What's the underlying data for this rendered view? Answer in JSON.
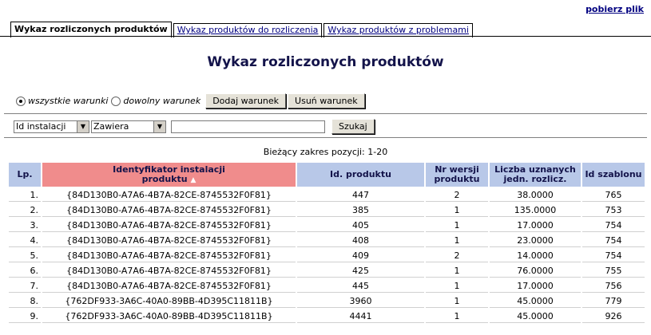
{
  "header": {
    "download_link": "pobierz plik"
  },
  "tabs": [
    {
      "label": "Wykaz rozliczonych produktów",
      "active": true
    },
    {
      "label": "Wykaz produktów do rozliczenia",
      "active": false
    },
    {
      "label": "Wykaz produktów z problemami",
      "active": false
    }
  ],
  "page_title": "Wykaz rozliczonych produktów",
  "conditions": {
    "radio_all": "wszystkie warunki",
    "radio_any": "dowolny warunek",
    "selected": "all",
    "add_button": "Dodaj warunek",
    "remove_button": "Usuń warunek"
  },
  "filter": {
    "field_select": "Id instalacji",
    "operator_select": "Zawiera",
    "value": "",
    "search_button": "Szukaj"
  },
  "range_text": "Bieżący zakres pozycji: 1-20",
  "table": {
    "columns": [
      "Lp.",
      "Identyfikator instalacji produktu",
      "Id. produktu",
      "Nr wersji produktu",
      "Liczba uznanych jedn. rozlicz.",
      "Id szablonu"
    ],
    "col_labels": {
      "lp": "Lp.",
      "install_id_1": "Identyfikator instalacji",
      "install_id_2": "produktu",
      "product_id": "Id. produktu",
      "version_1": "Nr wersji",
      "version_2": "produktu",
      "units_1": "Liczba uznanych",
      "units_2": "jedn. rozlicz.",
      "template": "Id szablonu"
    },
    "sort_indicator": "▲",
    "rows": [
      [
        "1.",
        "{84D130B0-A7A6-4B7A-82CE-8745532F0F81}",
        "447",
        "2",
        "38.0000",
        "765"
      ],
      [
        "2.",
        "{84D130B0-A7A6-4B7A-82CE-8745532F0F81}",
        "385",
        "1",
        "135.0000",
        "753"
      ],
      [
        "3.",
        "{84D130B0-A7A6-4B7A-82CE-8745532F0F81}",
        "405",
        "1",
        "17.0000",
        "754"
      ],
      [
        "4.",
        "{84D130B0-A7A6-4B7A-82CE-8745532F0F81}",
        "408",
        "1",
        "23.0000",
        "754"
      ],
      [
        "5.",
        "{84D130B0-A7A6-4B7A-82CE-8745532F0F81}",
        "409",
        "2",
        "14.0000",
        "754"
      ],
      [
        "6.",
        "{84D130B0-A7A6-4B7A-82CE-8745532F0F81}",
        "425",
        "1",
        "76.0000",
        "755"
      ],
      [
        "7.",
        "{84D130B0-A7A6-4B7A-82CE-8745532F0F81}",
        "445",
        "1",
        "17.0000",
        "756"
      ],
      [
        "8.",
        "{762DF933-3A6C-40A0-89BB-4D395C11811B}",
        "3960",
        "1",
        "45.0000",
        "779"
      ],
      [
        "9.",
        "{762DF933-3A6C-40A0-89BB-4D395C11811B}",
        "4441",
        "1",
        "45.0000",
        "926"
      ]
    ]
  }
}
